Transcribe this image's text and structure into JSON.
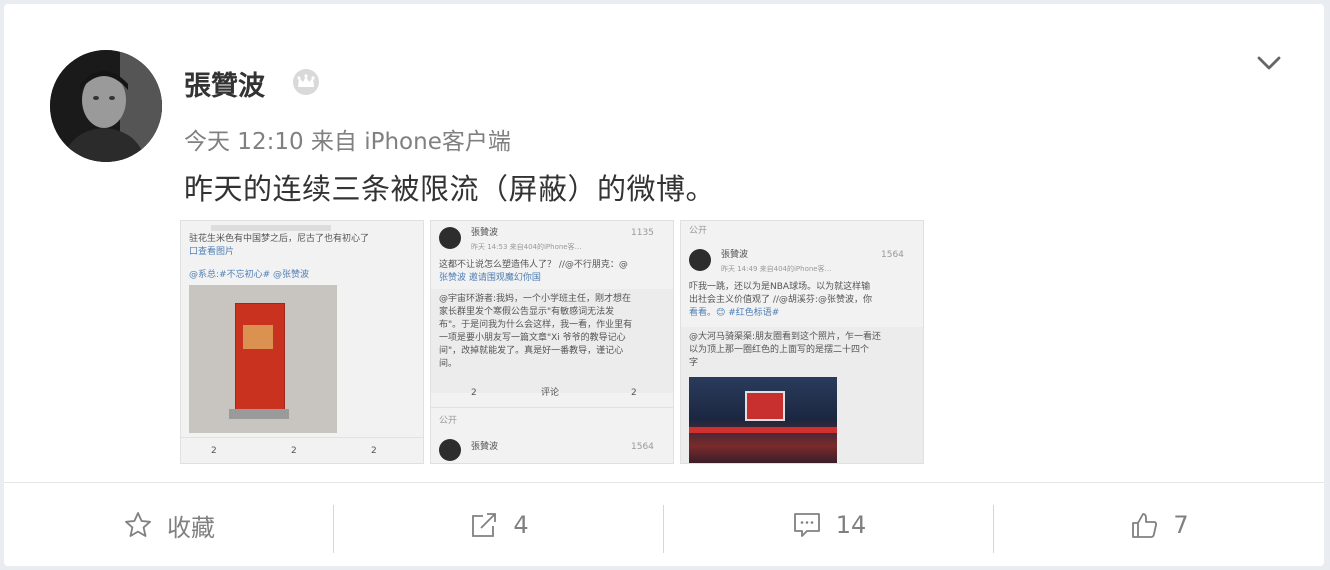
{
  "post": {
    "username": "張贊波",
    "timestamp": "今天 12:10",
    "source": "来自 iPhone客户端",
    "text": "昨天的连续三条被限流（屏蔽）的微博。"
  },
  "thumbnails": [
    {
      "line1": "驻花生米色有中国梦之后，尼古了也有初心了",
      "link": "口查看图片",
      "tags": "@系总:#不忘初心# @张赞波",
      "counts": [
        "2",
        "2",
        "2"
      ]
    },
    {
      "author": "張贊波",
      "badge": "1135",
      "time": "昨天 14:53 来自404的iPhone客…",
      "text1": "这都不让说怎么塑造伟人了？ //@不行朋克：@",
      "text2": "张赞波 邀请围观魔幻你国",
      "reply1": "@宇宙环游者:我妈，一个小学班主任，刚才想在",
      "reply2": "家长群里发个寒假公告显示\"有敏感词无法发",
      "reply3": "布\"。于是问我为什么会这样，我一看，作业里有",
      "reply4": "一项是要小朋友写一篇文章\"Xi 爷爷的教导记心",
      "reply5": "间\"，改掉就能发了。真是好一番教导，谨记心",
      "reply6": "间。",
      "counts": [
        "2",
        "评论",
        "2"
      ],
      "public": "公开",
      "author2": "張贊波",
      "badge2": "1564"
    },
    {
      "public": "公开",
      "author": "張贊波",
      "badge": "1564",
      "time": "昨天 14:49 来自404的iPhone客…",
      "text1": "吓我一跳，还以为是NBA球场。以为就这样输",
      "text2": "出社会主义价值观了 //@胡溪芬:@张赞波，你",
      "text3": "看看。😊 #红色标语#",
      "reply1": "@大河马骑渠渠:朋友圈看到这个照片，乍一看还",
      "reply2": "以为顶上那一圈红色的上面写的是摆二十四个",
      "reply3": "字"
    }
  ],
  "actions": {
    "favorite": "收藏",
    "repost": "4",
    "comment": "14",
    "like": "7"
  },
  "colors": {
    "background": "#e9edf1",
    "card": "#ffffff",
    "text_primary": "#333333",
    "text_secondary": "#808080",
    "link": "#4f7fb5"
  }
}
